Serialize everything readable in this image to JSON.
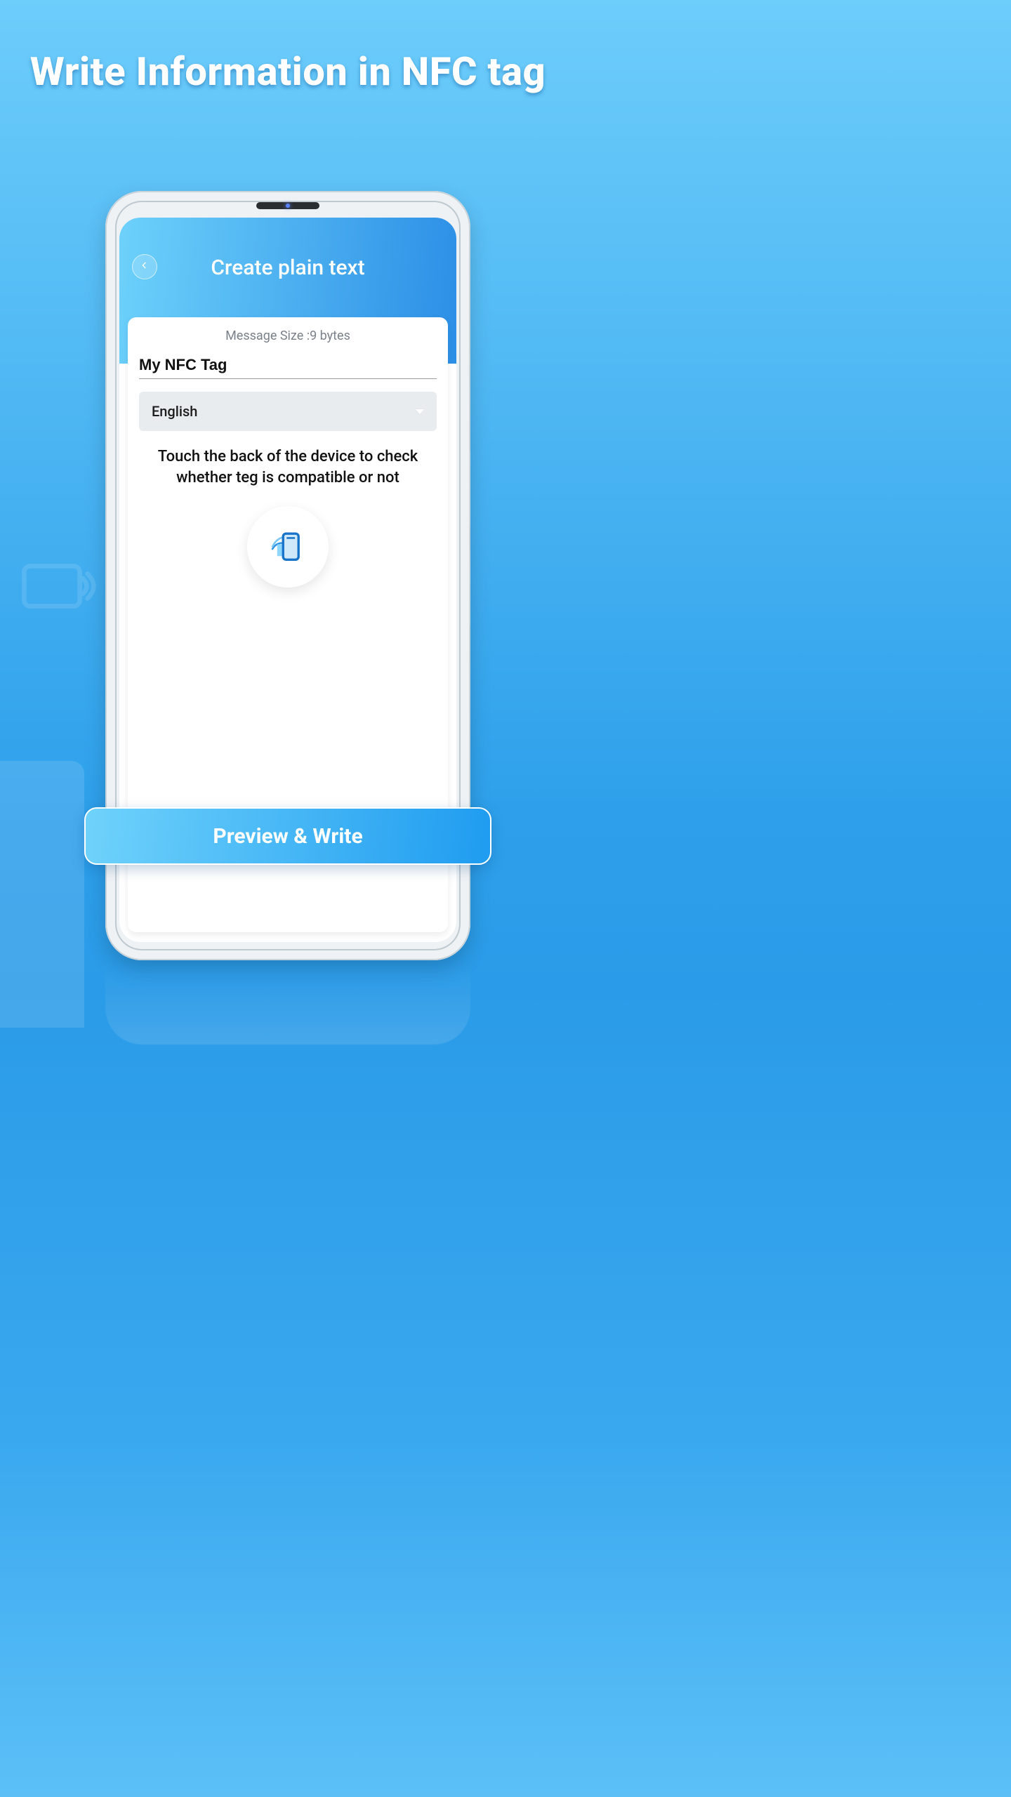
{
  "headline": "Write Information in NFC tag",
  "app": {
    "title": "Create plain text",
    "message_size_label": "Message Size :9 bytes",
    "input_value": "My NFC Tag",
    "language_selected": "English",
    "instruction": "Touch the back of the device to check whether teg is compatible or not"
  },
  "cta_label": "Preview & Write"
}
